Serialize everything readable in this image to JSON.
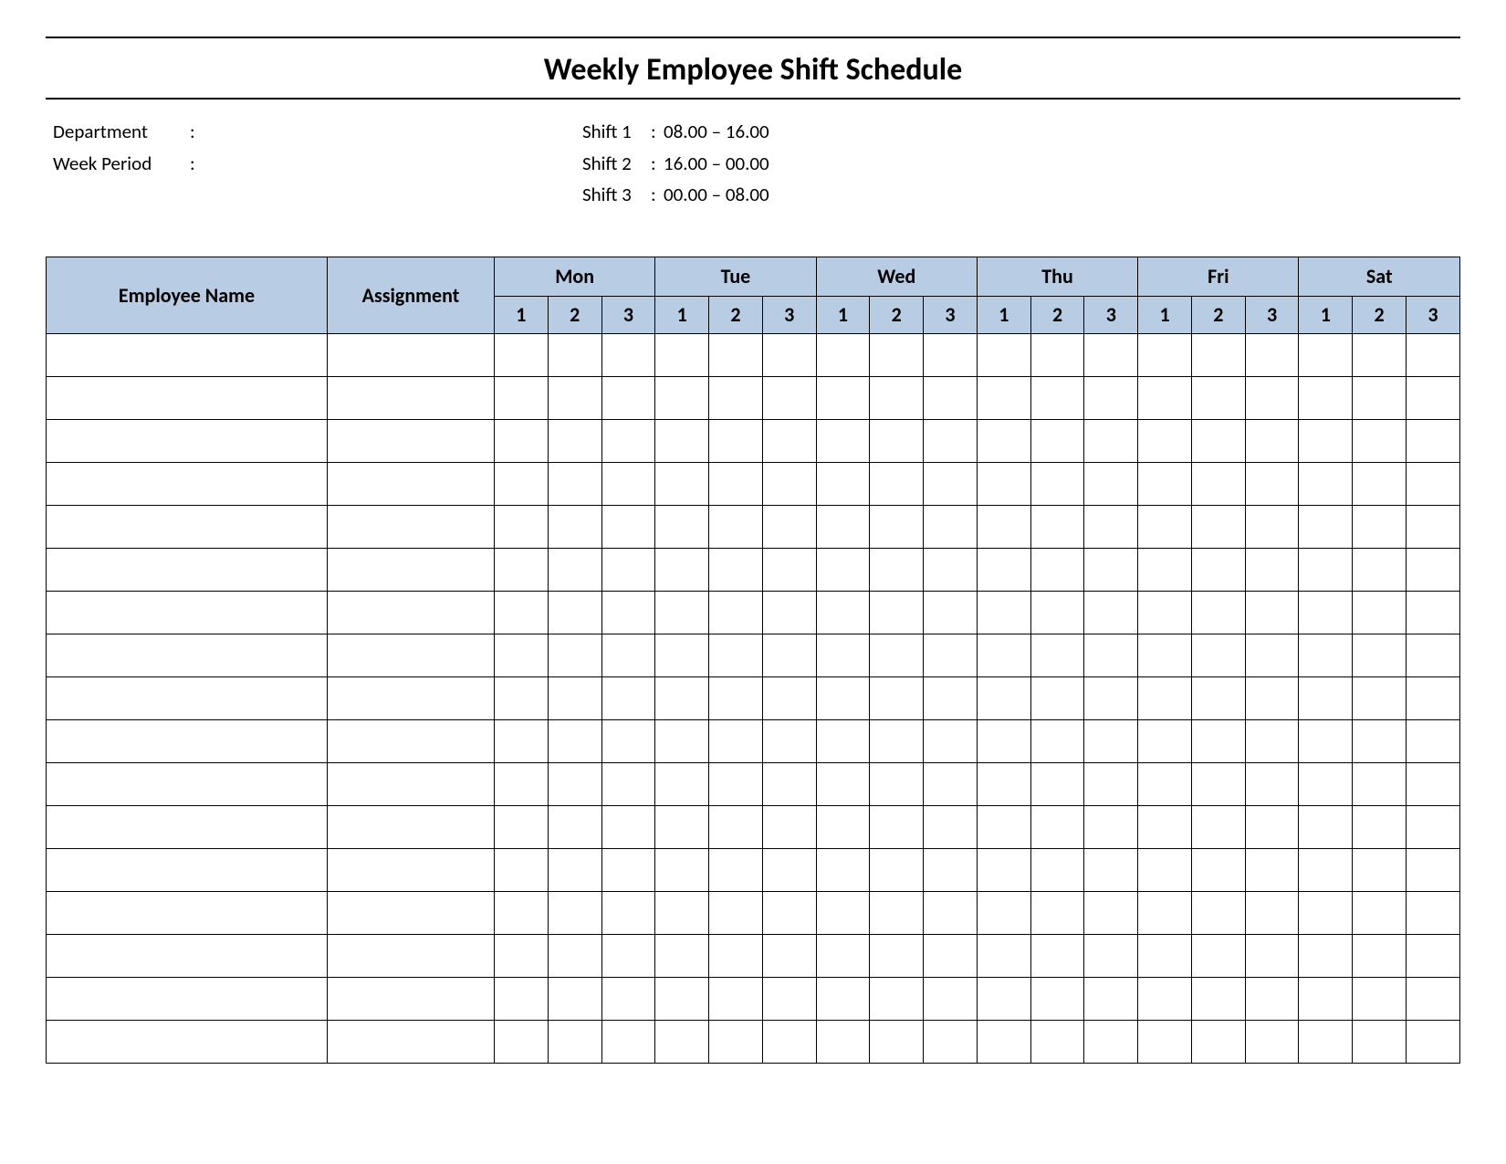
{
  "title": "Weekly Employee Shift Schedule",
  "meta": {
    "department_label": "Department",
    "department_value": "",
    "week_period_label": "Week  Period",
    "week_period_value": "",
    "shift1_label": "Shift 1",
    "shift1_value": "08.00  – 16.00",
    "shift2_label": "Shift 2",
    "shift2_value": "16.00  – 00.00",
    "shift3_label": "Shift 3",
    "shift3_value": "00.00  – 08.00"
  },
  "headers": {
    "employee_name": "Employee Name",
    "assignment": "Assignment",
    "days": [
      "Mon",
      "Tue",
      "Wed",
      "Thu",
      "Fri",
      "Sat"
    ],
    "shifts": [
      "1",
      "2",
      "3"
    ]
  },
  "row_count": 17,
  "colors": {
    "header_bg": "#b8cce4"
  }
}
